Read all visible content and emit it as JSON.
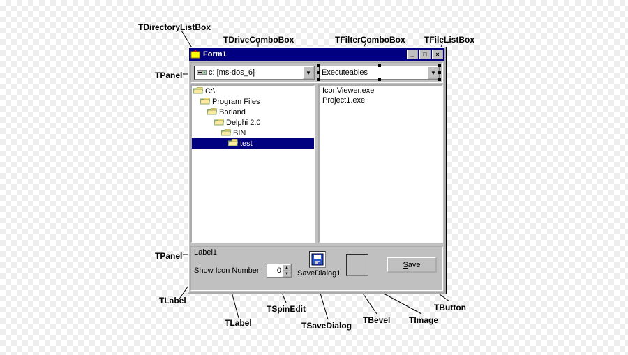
{
  "callouts": {
    "tdir": "TDirectoryListBox",
    "tdrive": "TDriveComboBox",
    "tfilter": "TFilterComboBox",
    "tfilelist": "TFileListBox",
    "tpanel1": "TPanel",
    "tpanel2": "TPanel",
    "tlabel1": "TLabel",
    "tlabel2": "TLabel",
    "tspinedit": "TSpinEdit",
    "tsavedialog": "TSaveDialog",
    "tbevel": "TBevel",
    "timage": "TImage",
    "tbutton": "TButton"
  },
  "window": {
    "title": "Form1"
  },
  "drive_combo": {
    "text": "c: [ms-dos_6]"
  },
  "filter_combo": {
    "text": "Executeables"
  },
  "dirs": [
    {
      "label": "C:\\",
      "indent": 0,
      "open": true,
      "sel": false
    },
    {
      "label": "Program Files",
      "indent": 1,
      "open": true,
      "sel": false
    },
    {
      "label": "Borland",
      "indent": 2,
      "open": true,
      "sel": false
    },
    {
      "label": "Delphi 2.0",
      "indent": 3,
      "open": true,
      "sel": false
    },
    {
      "label": "BIN",
      "indent": 4,
      "open": true,
      "sel": false
    },
    {
      "label": "test",
      "indent": 5,
      "open": true,
      "sel": true
    }
  ],
  "files": [
    "IconViewer.exe",
    "Project1.exe"
  ],
  "bottom": {
    "label1": "Label1",
    "show_icon": "Show Icon Number",
    "spin_value": "0",
    "savedialog": "SaveDialog1",
    "save_button": "Save",
    "save_underline_char": "S"
  }
}
